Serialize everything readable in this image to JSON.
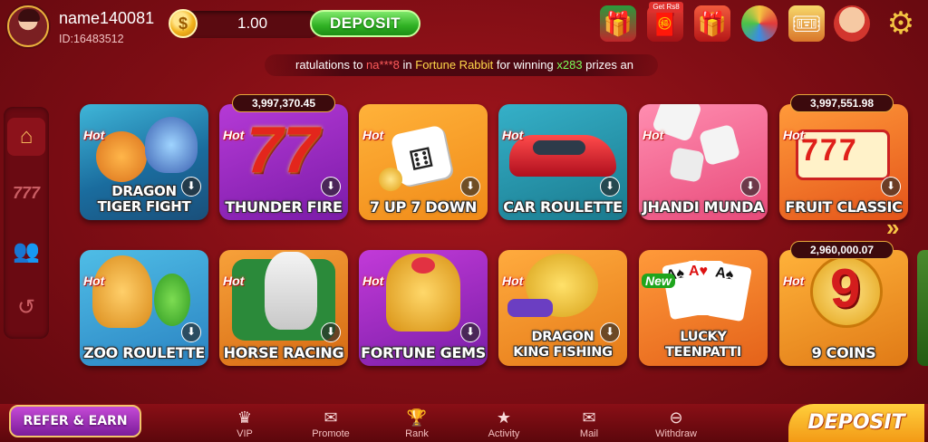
{
  "header": {
    "username": "name140081",
    "user_id": "ID:16483512",
    "balance": "1.00",
    "deposit_label": "DEPOSIT",
    "get_badge": "Get Rs8",
    "coin_symbol": "$"
  },
  "marquee": {
    "prefix": "ratulations to ",
    "winner": "na***8",
    "middle": " in ",
    "game": "Fortune Rabbit",
    "middle2": " for winning ",
    "multiplier": "x283",
    "suffix": " prizes an"
  },
  "games": [
    {
      "title": "DRAGON\nTIGER FIGHT",
      "badge": "Hot",
      "jackpot": ""
    },
    {
      "title": "THUNDER FIRE",
      "badge": "Hot",
      "jackpot": "3,997,370.45"
    },
    {
      "title": "7 UP 7 DOWN",
      "badge": "Hot",
      "jackpot": ""
    },
    {
      "title": "CAR ROULETTE",
      "badge": "Hot",
      "jackpot": ""
    },
    {
      "title": "JHANDI MUNDA",
      "badge": "Hot",
      "jackpot": ""
    },
    {
      "title": "FRUIT CLASSIC",
      "badge": "Hot",
      "jackpot": "3,997,551.98"
    },
    {
      "title": "ZOO ROULETTE",
      "badge": "Hot",
      "jackpot": ""
    },
    {
      "title": "HORSE RACING",
      "badge": "Hot",
      "jackpot": ""
    },
    {
      "title": "FORTUNE GEMS",
      "badge": "Hot",
      "jackpot": ""
    },
    {
      "title": "DRAGON\nKING FISHING",
      "badge": "Hot",
      "jackpot": ""
    },
    {
      "title": "LUCKY\nTEENPATTI",
      "badge": "New",
      "jackpot": ""
    },
    {
      "title": "9 COINS",
      "badge": "Hot",
      "jackpot": "2,960,000.07"
    }
  ],
  "bottom": {
    "refer": "REFER & EARN",
    "nav": [
      "VIP",
      "Promote",
      "Rank",
      "Activity",
      "Mail",
      "Withdraw"
    ],
    "deposit": "DEPOSIT"
  },
  "colors": {
    "background": "#8c111a",
    "deposit_green": "#2fb123",
    "accent_gold": "#f7c646"
  },
  "icons": {
    "sidebar": [
      "home-icon",
      "slots-777-icon",
      "people-icon",
      "history-icon"
    ],
    "top": [
      "gift-box-icon",
      "red-envelope-icon",
      "present-icon",
      "wheel-icon",
      "checkin-icon",
      "support-icon",
      "settings-gear-icon"
    ]
  }
}
